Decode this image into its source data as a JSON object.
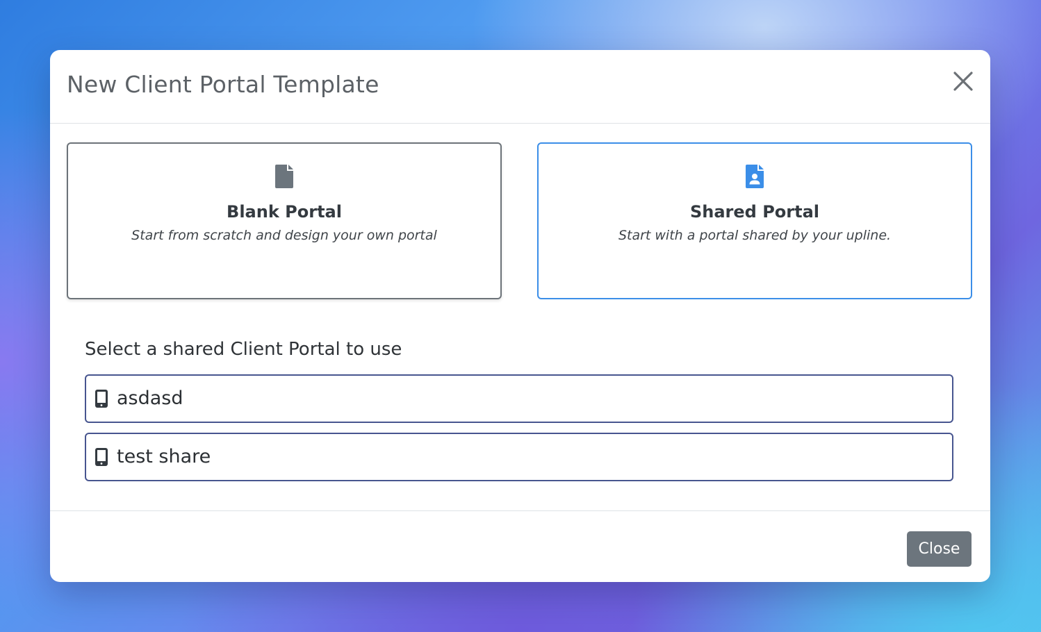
{
  "modal": {
    "title": "New Client Portal Template"
  },
  "options": [
    {
      "icon": "file-icon",
      "title": "Blank Portal",
      "description": "Start from scratch and design your own portal",
      "selected": false
    },
    {
      "icon": "user-file-icon",
      "title": "Shared Portal",
      "description": "Start with a portal shared by your upline.",
      "selected": true
    }
  ],
  "shared_section": {
    "label": "Select a shared Client Portal to use",
    "portals": [
      {
        "icon": "mobile-device-icon",
        "name": "asdasd"
      },
      {
        "icon": "mobile-device-icon",
        "name": "test share"
      }
    ]
  },
  "footer": {
    "close_label": "Close"
  },
  "colors": {
    "selected_border": "#3b8ee8",
    "unselected_border": "#6c7379",
    "list_border": "#47558f",
    "close_button_bg": "#6c757d",
    "icon_gray": "#6c757d",
    "icon_blue": "#3b8ee8"
  }
}
